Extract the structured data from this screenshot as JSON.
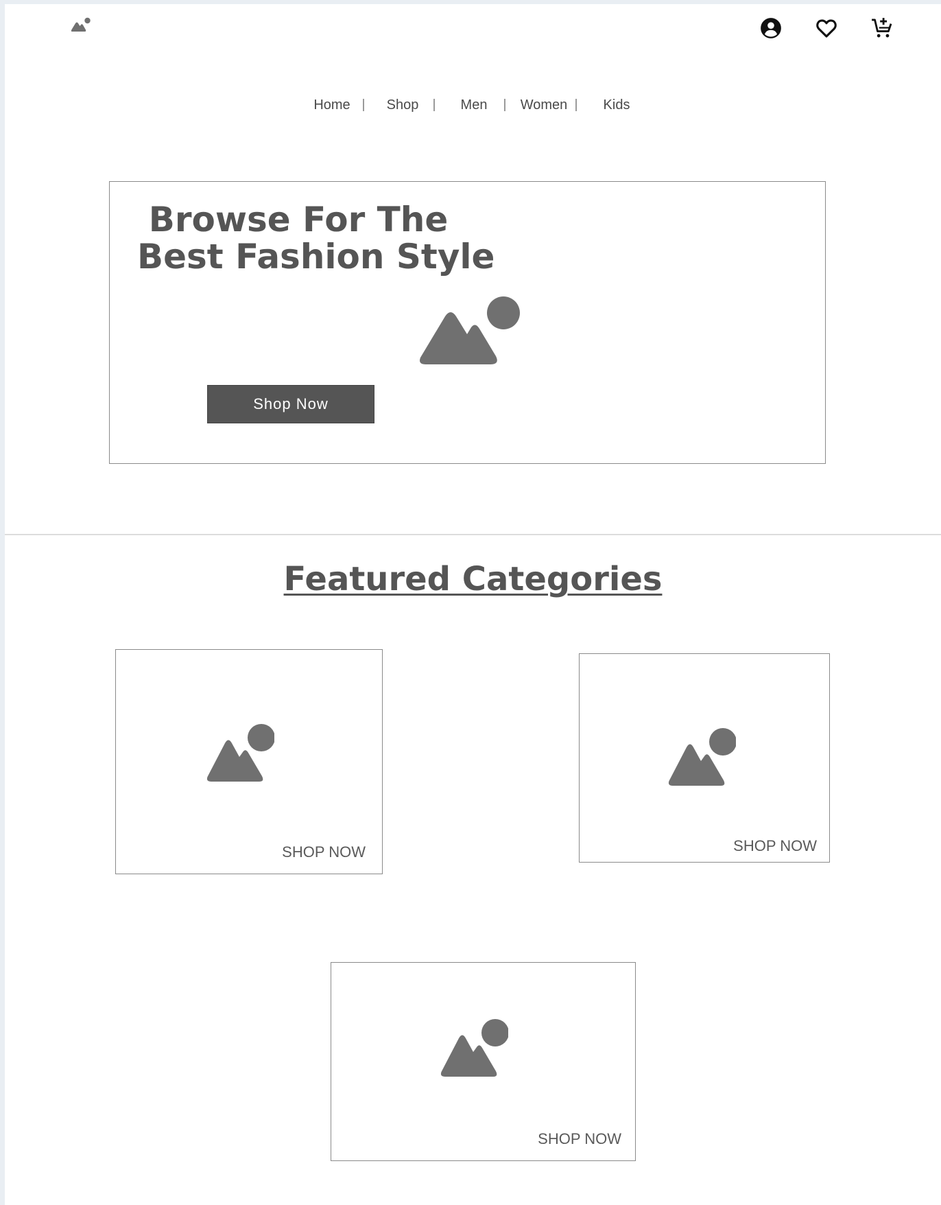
{
  "header": {
    "logo_icon": "image-placeholder-icon",
    "icons": [
      "account-circle-icon",
      "heart-icon",
      "add-to-cart-icon"
    ]
  },
  "nav": {
    "items": [
      {
        "label": "Home"
      },
      {
        "label": "Shop"
      },
      {
        "label": "Men"
      },
      {
        "label": "Women"
      },
      {
        "label": "Kids"
      }
    ]
  },
  "hero": {
    "title_line1": "Browse For The",
    "title_line2": "Best Fashion Style",
    "button_label": "Shop Now",
    "image_icon": "image-placeholder-icon"
  },
  "featured": {
    "title": "Featured Categories",
    "cards": [
      {
        "cta": "SHOP NOW",
        "image_icon": "image-placeholder-icon"
      },
      {
        "cta": "SHOP NOW",
        "image_icon": "image-placeholder-icon"
      },
      {
        "cta": "SHOP NOW",
        "image_icon": "image-placeholder-icon"
      }
    ]
  },
  "colors": {
    "text": "#555555",
    "placeholder": "#707070",
    "button": "#555555",
    "border": "#8a8a8a"
  }
}
